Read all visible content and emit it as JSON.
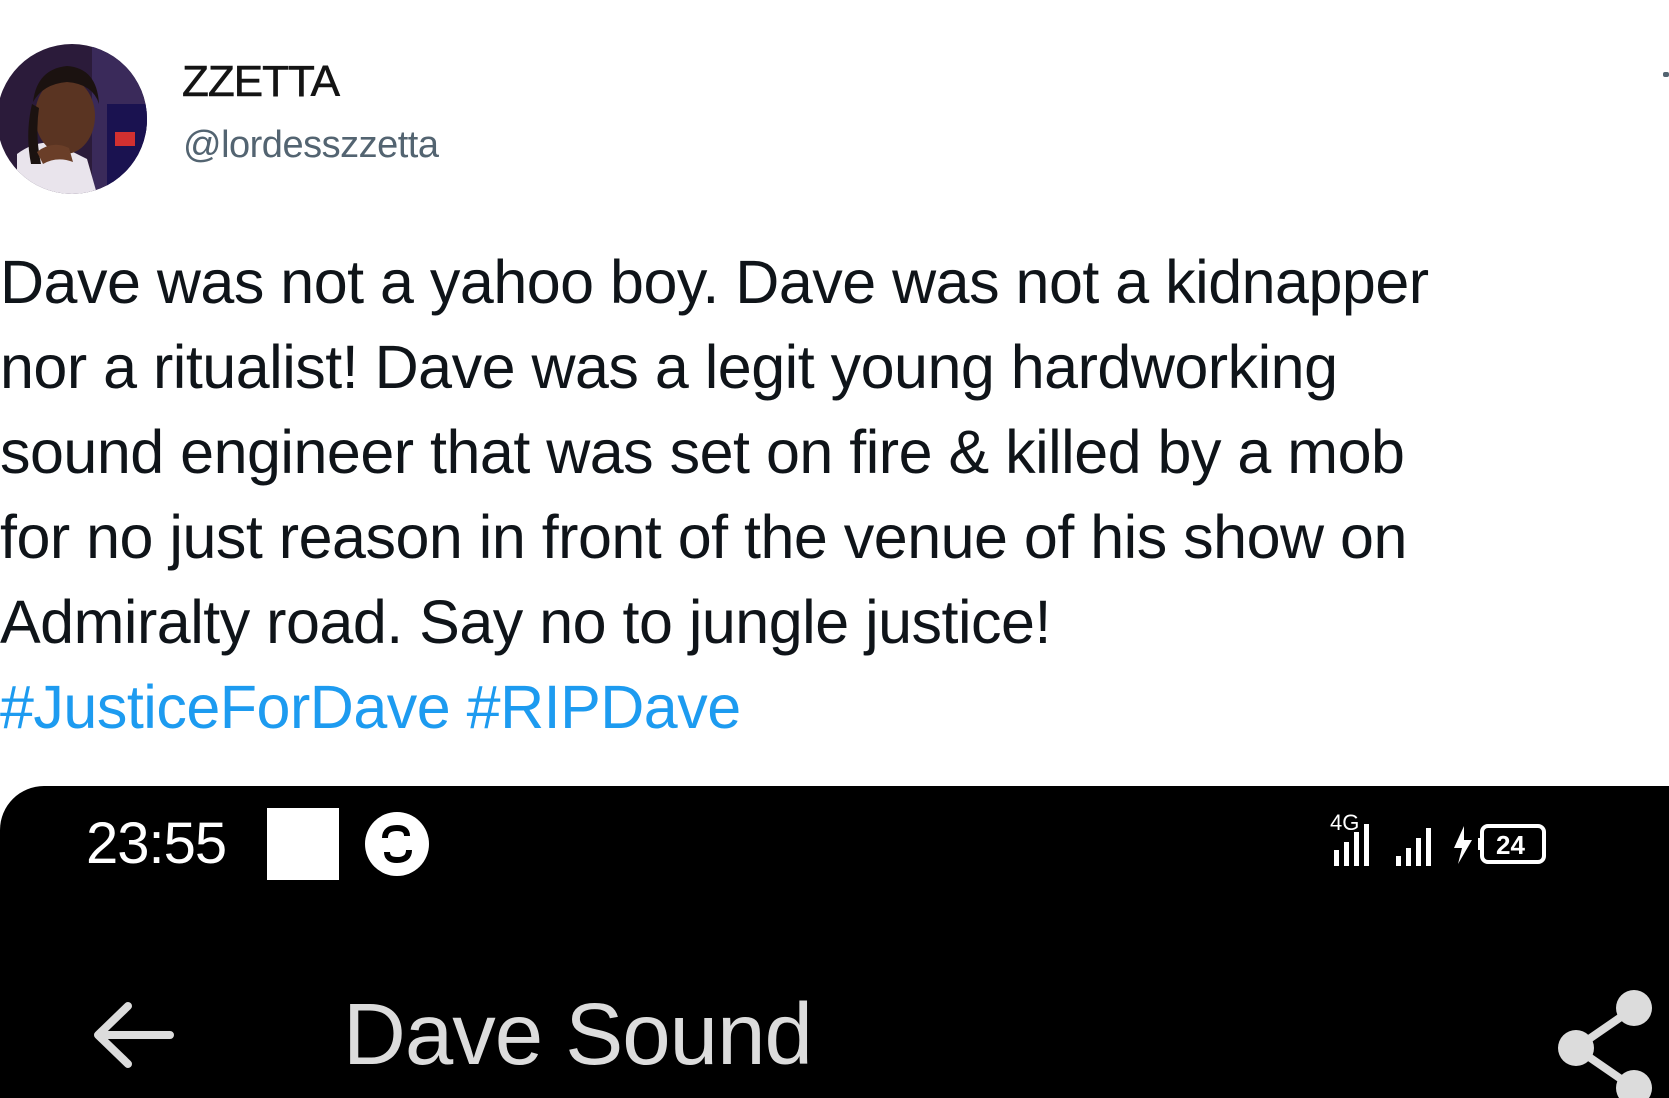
{
  "tweet": {
    "author": {
      "display_name": "ZZETTA",
      "handle": "@lordesszzetta",
      "avatar_icon": "profile-photo"
    },
    "text_lines": [
      "Dave was not a yahoo boy. Dave was not a kidnapper",
      "nor a ritualist! Dave was a legit young hardworking",
      "sound engineer that was set on fire & killed by a mob",
      "for no just reason in front of the venue of his show on",
      "Admiralty road. Say no to jungle justice!"
    ],
    "hashtags": [
      "#JusticeForDave",
      "#RIPDave"
    ],
    "colors": {
      "text": "#0f1419",
      "secondary": "#536471",
      "link": "#1d9bf0"
    }
  },
  "media": {
    "status_bar": {
      "time": "23:55",
      "network_label": "4G",
      "battery": "24"
    },
    "header": {
      "back_icon": "arrow-left-icon",
      "title": "Dave Sound",
      "share_icon": "share-icon"
    },
    "colors": {
      "background": "#000000",
      "text": "#ffffff"
    }
  }
}
